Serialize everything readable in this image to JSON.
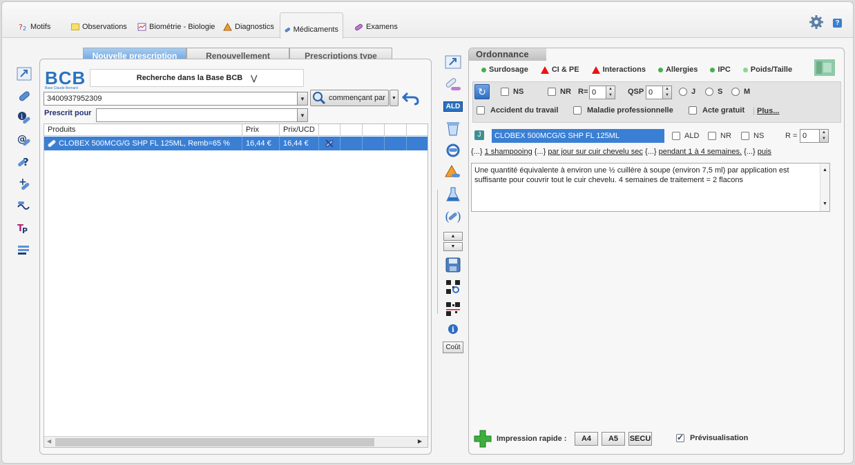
{
  "tabs": [
    {
      "label": "Motifs",
      "icon": "motifs-icon"
    },
    {
      "label": "Observations",
      "icon": "note-icon"
    },
    {
      "label": "Biométrie - Biologie",
      "icon": "biometry-icon"
    },
    {
      "label": "Diagnostics",
      "icon": "diagnostic-icon"
    },
    {
      "label": "Médicaments",
      "icon": "pill-icon",
      "active": true
    },
    {
      "label": "Examens",
      "icon": "exam-icon"
    }
  ],
  "header": {
    "help_label": "?"
  },
  "prescription_tabs": [
    "Nouvelle prescription",
    "Renouvellement",
    "Prescriptions type"
  ],
  "bcb": {
    "logo": "BCB",
    "logo_sub": "Base Claude Bernard",
    "search_title": "Recherche dans la Base BCB",
    "search_value": "3400937952309",
    "search_mode": "commençant par",
    "prescrit_pour_label": "Prescrit pour",
    "prescrit_pour_value": ""
  },
  "products_table": {
    "columns": [
      "Produits",
      "Prix",
      "Prix/UCD",
      "",
      "",
      "",
      "",
      ""
    ],
    "rows": [
      {
        "product": "CLOBEX 500MCG/G SHP FL 125ML, Remb=65 %",
        "prix": "16,44 €",
        "prix_ucd": "16,44 €"
      }
    ]
  },
  "ordonnance": {
    "title": "Ordonnance",
    "alerts": [
      {
        "label": "Surdosage",
        "kind": "dot",
        "color": "#45b04a"
      },
      {
        "label": "CI & PE",
        "kind": "triangle",
        "color": "#e11111"
      },
      {
        "label": "Interactions",
        "kind": "triangle",
        "color": "#e11111"
      },
      {
        "label": "Allergies",
        "kind": "dot",
        "color": "#45b04a"
      },
      {
        "label": "IPC",
        "kind": "dot",
        "color": "#45b04a"
      },
      {
        "label": "Poids/Taille",
        "kind": "dot",
        "color": "#8fd48f"
      }
    ],
    "options": {
      "ns_label": "NS",
      "nr_label": "NR",
      "r_label": "R=",
      "r_value": "0",
      "qsp_label": "QSP",
      "qsp_value": "0",
      "j_label": "J",
      "s_label": "S",
      "m_label": "M",
      "accident_label": "Accident du travail",
      "maladie_label": "Maladie professionnelle",
      "acte_label": "Acte gratuit",
      "plus_label": "Plus..."
    },
    "medication": {
      "icon_letter": "J",
      "name": "CLOBEX 500MCG/G SHP FL 125ML",
      "ald_label": "ALD",
      "nr_label": "NR",
      "ns_label": "NS",
      "r_label": "R =",
      "r_value": "0",
      "posology": {
        "p1": "{...}",
        "p2": "1 shampooing",
        "p3": "{...}",
        "p4": "par jour sur cuir chevelu sec",
        "p5": "{...}",
        "p6": "pendant 1 à 4 semaines.",
        "p7": "{...}",
        "p8": "puis"
      },
      "note": "Une quantité équivalente à environ une ½ cuillère à soupe (environ 7,5 ml) par application est suffisante pour couvrir tout le cuir chevelu. 4 semaines de traitement = 2 flacons"
    },
    "footer": {
      "impression_label": "Impression rapide :",
      "a4": "A4",
      "a5": "A5",
      "secu": "SECU",
      "preview_label": "Prévisualisation",
      "preview_checked": true
    }
  },
  "middle_tools": {
    "ald_label": "ALD",
    "cout_label": "Coût"
  }
}
